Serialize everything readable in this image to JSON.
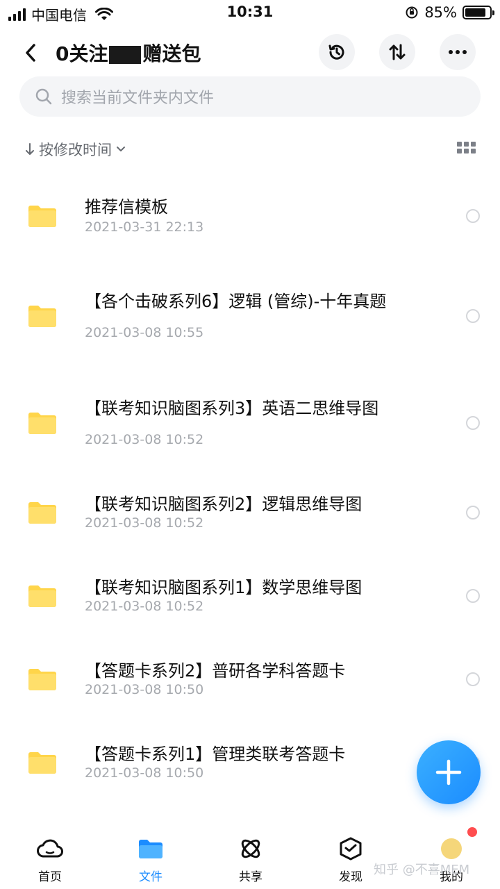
{
  "status_bar": {
    "carrier": "中国电信",
    "time": "10:31",
    "battery_percent": "85%",
    "battery_level": 0.85
  },
  "header": {
    "title_left": "0关注",
    "title_right": "赠送包",
    "back_icon": "chevron-left-icon",
    "history_icon": "history-icon",
    "sort_icon": "sort-arrows-icon",
    "more_icon": "more-dots-icon"
  },
  "search": {
    "placeholder": "搜索当前文件夹内文件"
  },
  "sort_bar": {
    "label": "按修改时间",
    "view_icon": "grid-view-icon"
  },
  "files": [
    {
      "name": "推荐信模板",
      "date": "2021-03-31 22:13"
    },
    {
      "name": "【各个击破系列6】逻辑 (管综)-十年真题",
      "date": "2021-03-08 10:55"
    },
    {
      "name": "【联考知识脑图系列3】英语二思维导图",
      "date": "2021-03-08 10:52"
    },
    {
      "name": "【联考知识脑图系列2】逻辑思维导图",
      "date": "2021-03-08 10:52"
    },
    {
      "name": "【联考知识脑图系列1】数学思维导图",
      "date": "2021-03-08 10:52"
    },
    {
      "name": "【答题卡系列2】普研各学科答题卡",
      "date": "2021-03-08 10:50"
    },
    {
      "name": "【答题卡系列1】管理类联考答题卡",
      "date": "2021-03-08 10:50"
    }
  ],
  "colors": {
    "accent": "#1b8cff",
    "folder": "#ffd54a",
    "date": "#a6a9ae"
  },
  "tabbar": {
    "tabs": [
      {
        "label": "首页",
        "icon": "cloud-icon"
      },
      {
        "label": "文件",
        "icon": "folder-icon"
      },
      {
        "label": "共享",
        "icon": "atom-share-icon"
      },
      {
        "label": "发现",
        "icon": "box-discover-icon"
      },
      {
        "label": "我的",
        "icon": "avatar-icon"
      }
    ]
  },
  "watermark": "知乎 @不喜MEM"
}
